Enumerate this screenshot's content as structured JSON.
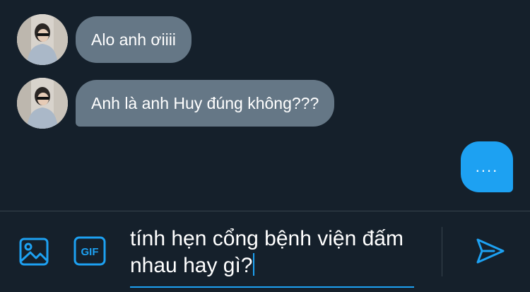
{
  "conversation": {
    "messages": [
      {
        "sender": "other",
        "text": "Alo anh ơiiii",
        "avatar_icon": "user-avatar"
      },
      {
        "sender": "other",
        "text": "Anh là anh Huy đúng không???",
        "avatar_icon": "user-avatar"
      }
    ],
    "typing_indicator": "...."
  },
  "composer": {
    "media_icon": "image-icon",
    "gif_label": "GIF",
    "input_text": "tính hẹn cổng bệnh viện đấm nhau hay gì?",
    "send_icon": "send-icon"
  },
  "colors": {
    "background": "#15202b",
    "incoming_bubble": "#657786",
    "accent": "#1da1f2",
    "divider": "#38444d"
  }
}
